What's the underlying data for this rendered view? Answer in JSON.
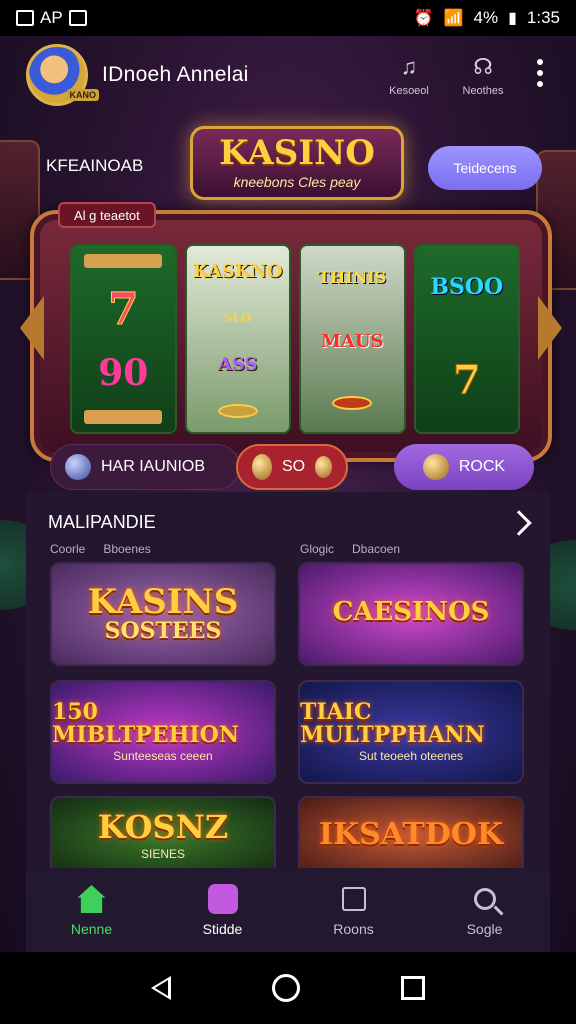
{
  "status_bar": {
    "left_text": "AP",
    "battery": "4%",
    "time": "1:35"
  },
  "header": {
    "username": "IDnoeh Annelai",
    "avatar_tag": "KANO",
    "buttons": [
      {
        "label": "Kesoeol",
        "icon": "music-icon"
      },
      {
        "label": "Neothes",
        "icon": "headset-icon"
      }
    ]
  },
  "top": {
    "left_label": "KFEAINOAB",
    "logo_title": "KASINO",
    "logo_sub": "kneebons Cles peay",
    "pill_button": "Teidecens"
  },
  "slot": {
    "tag": "Al g teaetot",
    "reels": [
      {
        "top": "7",
        "middle": "90",
        "bottom": ""
      },
      {
        "top": "KASKNO",
        "middle": "ASS",
        "bottom": "SLO"
      },
      {
        "top": "THINIS",
        "middle": "MAUS",
        "bottom": ""
      },
      {
        "top": "BSOO",
        "middle": "7",
        "bottom": ""
      }
    ]
  },
  "actions": {
    "primary": "HAR IAUNIOB",
    "secondary": "SO",
    "tertiary": "ROCK"
  },
  "games": {
    "title": "MALIPANDIE",
    "col_left_labels": [
      "Coorle",
      "Bboenes"
    ],
    "col_right_labels": [
      "Glogic",
      "Dbacoen"
    ],
    "cards": [
      {
        "title": "KASINS",
        "sub": "SOSTEES"
      },
      {
        "title": "CAESINOS",
        "sub": ""
      },
      {
        "title": "150 MIBLTPEHION",
        "sub": "Sunteeseas ceeen"
      },
      {
        "title": "TIAIC MULTPPHANN",
        "sub": "Sut teoeeh oteenes"
      },
      {
        "title": "KOSNZ",
        "sub": "SIENES"
      },
      {
        "title": "IKSATDOK",
        "sub": ""
      }
    ]
  },
  "bottom_nav": [
    {
      "label": "Nenne",
      "icon": "home-icon"
    },
    {
      "label": "Stidde",
      "icon": "shop-icon"
    },
    {
      "label": "Roons",
      "icon": "bag-icon"
    },
    {
      "label": "Sogle",
      "icon": "search-icon"
    }
  ],
  "colors": {
    "accent_green": "#4ddc6a",
    "accent_purple": "#7b6ef0",
    "gold": "#ffcf40",
    "action_red": "#a8232e"
  }
}
